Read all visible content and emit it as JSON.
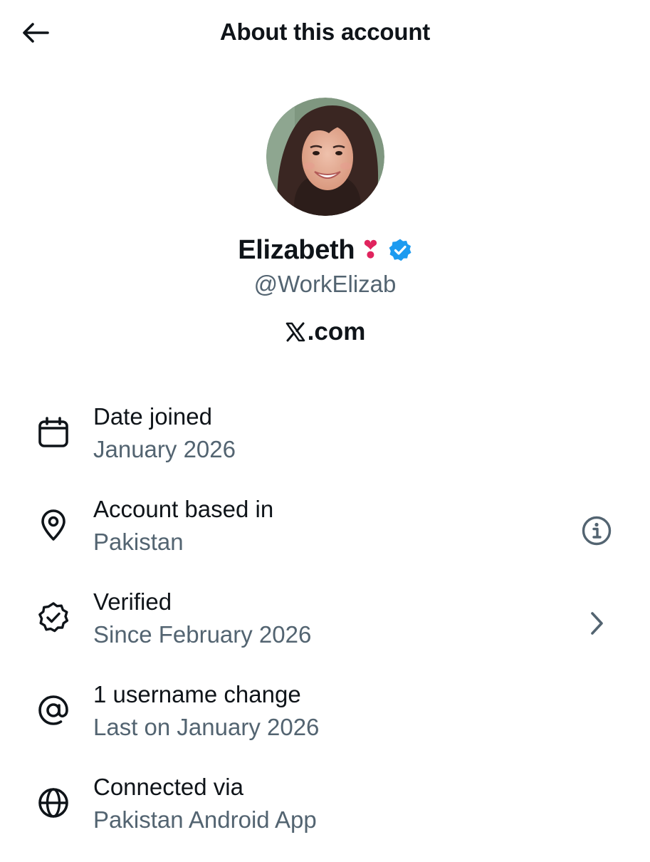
{
  "header": {
    "title": "About this account",
    "back_icon": "arrow-left-icon"
  },
  "profile": {
    "display_name": "Elizabeth",
    "emoji": "❣",
    "handle": "@WorkElizab",
    "verified_color": "#1d9bf0",
    "site": ".com",
    "site_icon": "x-logo-icon"
  },
  "details": [
    {
      "icon": "calendar-icon",
      "title": "Date joined",
      "value": "January 2026"
    },
    {
      "icon": "location-pin-icon",
      "title": "Account based in",
      "value": "Pakistan",
      "action_icon": "info-icon"
    },
    {
      "icon": "verified-badge-icon",
      "title": "Verified",
      "value": "Since February 2026",
      "action_icon": "chevron-right-icon"
    },
    {
      "icon": "at-sign-icon",
      "title": "1 username change",
      "value": "Last on January 2026"
    },
    {
      "icon": "globe-icon",
      "title": "Connected via",
      "value": "Pakistan Android App"
    }
  ],
  "colors": {
    "text_primary": "#0f1419",
    "text_secondary": "#536471",
    "accent": "#1d9bf0"
  }
}
